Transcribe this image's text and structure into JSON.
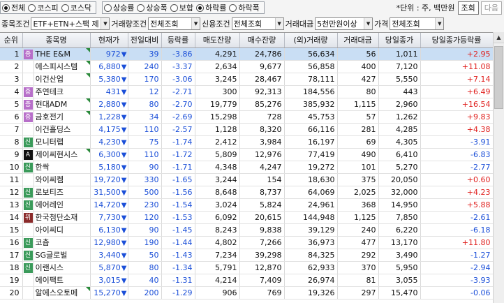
{
  "market_radios": [
    {
      "label": "전체",
      "checked": true
    },
    {
      "label": "코스피",
      "checked": false
    },
    {
      "label": "코스닥",
      "checked": false
    }
  ],
  "sort_radios": [
    {
      "label": "상승률",
      "checked": false
    },
    {
      "label": "상승폭",
      "checked": false
    },
    {
      "label": "보합",
      "checked": false
    },
    {
      "label": "하락률",
      "checked": true
    },
    {
      "label": "하락폭",
      "checked": false
    }
  ],
  "unit_text": "*단위 : 주, 백만원",
  "buttons": {
    "search": "조회",
    "next": "다음"
  },
  "filters": [
    {
      "label": "종목조건",
      "value": "ETF+ETN+스팩 제"
    },
    {
      "label": "거래량조건",
      "value": "전체조회"
    },
    {
      "label": "신용조건",
      "value": "전체조회"
    },
    {
      "label": "거래대금",
      "value": "5천만원이상"
    },
    {
      "label": "가격",
      "value": "전체조회"
    }
  ],
  "columns": [
    "순위",
    "종목명",
    "현재가",
    "전일대비",
    "등락률",
    "매도잔량",
    "매수잔량",
    "(외)거래량",
    "거래대금",
    "당일종가",
    "당일종가등락률"
  ],
  "badge_colors": {
    "증": "#b76fc9",
    "신": "#3a9a5a",
    "위": "#8a2a2a",
    "A": "#111111"
  },
  "arrow_icon": "down-triangle-icon",
  "rows": [
    {
      "rank": "1",
      "badge": "증",
      "name": "THE E&M",
      "tri": true,
      "price": "972",
      "diff": "39",
      "rate": "-3.86",
      "ask": "4,291",
      "bid": "24,786",
      "volume": "56,634",
      "amount": "56",
      "close": "1,011",
      "close_rate": "+2.95"
    },
    {
      "rank": "2",
      "badge": "",
      "name": "에스피시스템",
      "tri": true,
      "price": "6,880",
      "diff": "240",
      "rate": "-3.37",
      "ask": "2,634",
      "bid": "9,677",
      "volume": "56,858",
      "amount": "400",
      "close": "7,120",
      "close_rate": "+11.08"
    },
    {
      "rank": "3",
      "badge": "",
      "name": "이건산업",
      "tri": true,
      "price": "5,380",
      "diff": "170",
      "rate": "-3.06",
      "ask": "3,245",
      "bid": "28,467",
      "volume": "78,111",
      "amount": "427",
      "close": "5,550",
      "close_rate": "+7.14"
    },
    {
      "rank": "4",
      "badge": "증",
      "name": "주연테크",
      "tri": false,
      "price": "431",
      "diff": "12",
      "rate": "-2.71",
      "ask": "300",
      "bid": "92,313",
      "volume": "184,556",
      "amount": "80",
      "close": "443",
      "close_rate": "+6.49"
    },
    {
      "rank": "5",
      "badge": "증",
      "name": "현대ADM",
      "tri": true,
      "price": "2,880",
      "diff": "80",
      "rate": "-2.70",
      "ask": "19,779",
      "bid": "85,276",
      "volume": "385,932",
      "amount": "1,115",
      "close": "2,960",
      "close_rate": "+16.54"
    },
    {
      "rank": "6",
      "badge": "증",
      "name": "금호전기",
      "tri": true,
      "price": "1,228",
      "diff": "34",
      "rate": "-2.69",
      "ask": "15,298",
      "bid": "728",
      "volume": "45,753",
      "amount": "57",
      "close": "1,262",
      "close_rate": "+9.83"
    },
    {
      "rank": "7",
      "badge": "",
      "name": "이건홀딩스",
      "tri": false,
      "price": "4,175",
      "diff": "110",
      "rate": "-2.57",
      "ask": "1,128",
      "bid": "8,320",
      "volume": "66,116",
      "amount": "281",
      "close": "4,285",
      "close_rate": "+4.38"
    },
    {
      "rank": "8",
      "badge": "신",
      "name": "모니터랩",
      "tri": false,
      "price": "4,230",
      "diff": "75",
      "rate": "-1.74",
      "ask": "2,412",
      "bid": "3,984",
      "volume": "16,197",
      "amount": "69",
      "close": "4,305",
      "close_rate": "-3.91"
    },
    {
      "rank": "9",
      "badge": "A",
      "name": "제이씨현시스",
      "tri": true,
      "price": "6,300",
      "diff": "110",
      "rate": "-1.72",
      "ask": "5,809",
      "bid": "12,976",
      "volume": "77,419",
      "amount": "490",
      "close": "6,410",
      "close_rate": "-6.83"
    },
    {
      "rank": "10",
      "badge": "신",
      "name": "한싹",
      "tri": false,
      "price": "5,180",
      "diff": "90",
      "rate": "-1.71",
      "ask": "4,348",
      "bid": "4,247",
      "volume": "19,272",
      "amount": "101",
      "close": "5,270",
      "close_rate": "-2.77"
    },
    {
      "rank": "11",
      "badge": "",
      "name": "와이씨켐",
      "tri": false,
      "price": "19,720",
      "diff": "330",
      "rate": "-1.65",
      "ask": "3,244",
      "bid": "154",
      "volume": "18,630",
      "amount": "375",
      "close": "20,050",
      "close_rate": "+0.60"
    },
    {
      "rank": "12",
      "badge": "신",
      "name": "로보티즈",
      "tri": false,
      "price": "31,500",
      "diff": "500",
      "rate": "-1.56",
      "ask": "8,648",
      "bid": "8,737",
      "volume": "64,069",
      "amount": "2,025",
      "close": "32,000",
      "close_rate": "+4.23"
    },
    {
      "rank": "13",
      "badge": "신",
      "name": "에어레인",
      "tri": false,
      "price": "14,720",
      "diff": "230",
      "rate": "-1.54",
      "ask": "3,024",
      "bid": "5,824",
      "volume": "24,961",
      "amount": "368",
      "close": "14,950",
      "close_rate": "+5.88"
    },
    {
      "rank": "14",
      "badge": "위",
      "name": "한국첨단소재",
      "tri": false,
      "price": "7,730",
      "diff": "120",
      "rate": "-1.53",
      "ask": "6,092",
      "bid": "20,615",
      "volume": "144,948",
      "amount": "1,125",
      "close": "7,850",
      "close_rate": "-2.61"
    },
    {
      "rank": "15",
      "badge": "",
      "name": "아이씨디",
      "tri": false,
      "price": "6,130",
      "diff": "90",
      "rate": "-1.45",
      "ask": "8,243",
      "bid": "9,838",
      "volume": "39,129",
      "amount": "240",
      "close": "6,220",
      "close_rate": "-6.18"
    },
    {
      "rank": "16",
      "badge": "신",
      "name": "코츕",
      "tri": false,
      "price": "12,980",
      "diff": "190",
      "rate": "-1.44",
      "ask": "4,802",
      "bid": "7,266",
      "volume": "36,973",
      "amount": "477",
      "close": "13,170",
      "close_rate": "+11.80"
    },
    {
      "rank": "17",
      "badge": "신",
      "name": "SG글로벌",
      "tri": false,
      "price": "3,440",
      "diff": "50",
      "rate": "-1.43",
      "ask": "7,234",
      "bid": "39,298",
      "volume": "84,325",
      "amount": "292",
      "close": "3,490",
      "close_rate": "-1.27"
    },
    {
      "rank": "18",
      "badge": "신",
      "name": "이랜시스",
      "tri": false,
      "price": "5,870",
      "diff": "80",
      "rate": "-1.34",
      "ask": "5,791",
      "bid": "12,870",
      "volume": "62,933",
      "amount": "370",
      "close": "5,950",
      "close_rate": "-2.94"
    },
    {
      "rank": "19",
      "badge": "",
      "name": "에이팩트",
      "tri": false,
      "price": "3,015",
      "diff": "40",
      "rate": "-1.31",
      "ask": "4,214",
      "bid": "7,409",
      "volume": "26,974",
      "amount": "81",
      "close": "3,055",
      "close_rate": "-3.93"
    },
    {
      "rank": "20",
      "badge": "",
      "name": "알에스오토메",
      "tri": true,
      "price": "15,270",
      "diff": "200",
      "rate": "-1.29",
      "ask": "906",
      "bid": "769",
      "volume": "19,326",
      "amount": "297",
      "close": "15,470",
      "close_rate": "-0.06"
    }
  ]
}
